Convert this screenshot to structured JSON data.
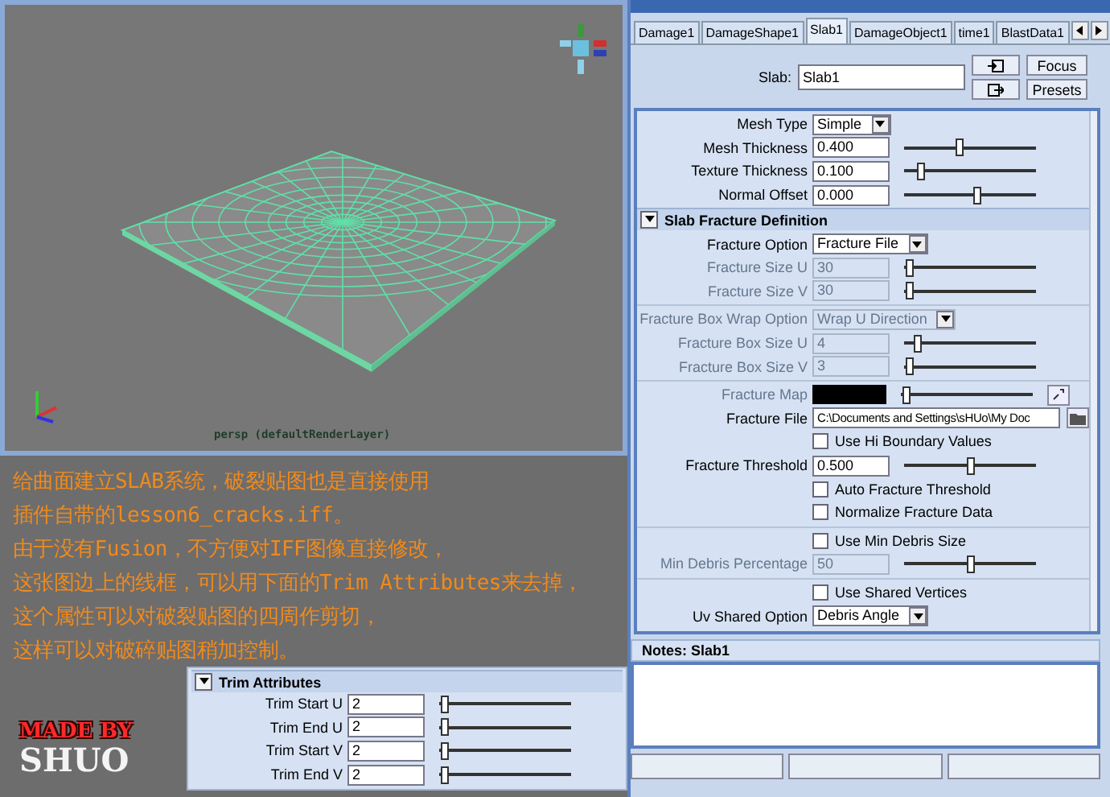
{
  "viewport": {
    "camera_label": "persp (defaultRenderLayer)"
  },
  "caption": {
    "lines": [
      "给曲面建立SLAB系统，破裂贴图也是直接使用",
      "插件自带的lesson6_cracks.iff。",
      "由于没有Fusion，不方便对IFF图像直接修改，",
      "这张图边上的线框，可以用下面的Trim Attributes来去掉，",
      "这个属性可以对破裂贴图的四周作剪切，",
      "这样可以对破碎贴图稍加控制。"
    ]
  },
  "signature": {
    "line_1": "MADE BY",
    "line_2": "SHUO"
  },
  "trim_attributes": {
    "title": "Trim Attributes",
    "expanded": true,
    "rows": [
      {
        "label": "Trim Start U",
        "value": "2",
        "level": 0.04
      },
      {
        "label": "Trim End U",
        "value": "2",
        "level": 0.04
      },
      {
        "label": "Trim Start V",
        "value": "2",
        "level": 0.04
      },
      {
        "label": "Trim End V",
        "value": "2",
        "level": 0.04
      }
    ]
  },
  "tabs": [
    {
      "label": "Damage1",
      "selected": false
    },
    {
      "label": "DamageShape1",
      "selected": false
    },
    {
      "label": "Slab1",
      "selected": true
    },
    {
      "label": "DamageObject1",
      "selected": false
    },
    {
      "label": "time1",
      "selected": false
    },
    {
      "label": "BlastData1",
      "selected": false
    }
  ],
  "node": {
    "label": "Slab:",
    "value": "Slab1",
    "buttons": [
      "Focus",
      "Presets"
    ]
  },
  "attributes": [
    {
      "kind": "dropdown",
      "label": "Mesh Type",
      "value": "Simple",
      "disabled": false
    },
    {
      "kind": "number",
      "label": "Mesh Thickness",
      "value": "0.400",
      "level": 0.42,
      "disabled": false
    },
    {
      "kind": "number",
      "label": "Texture Thickness",
      "value": "0.100",
      "level": 0.12,
      "disabled": false
    },
    {
      "kind": "number",
      "label": "Normal Offset",
      "value": "0.000",
      "level": 0.55,
      "disabled": false
    }
  ],
  "fracture_section": {
    "title": "Slab Fracture Definition",
    "expanded": true,
    "groups": [
      [
        {
          "kind": "dropdown",
          "label": "Fracture Option",
          "value": "Fracture File",
          "disabled": false
        },
        {
          "kind": "number",
          "label": "Fracture Size U",
          "value": "30",
          "level": 0.04,
          "disabled": true
        },
        {
          "kind": "number",
          "label": "Fracture Size V",
          "value": "30",
          "level": 0.04,
          "disabled": true
        }
      ],
      [
        {
          "kind": "dropdown",
          "label": "Fracture Box Wrap Option",
          "value": "Wrap U Direction",
          "disabled": true
        },
        {
          "kind": "number",
          "label": "Fracture Box Size U",
          "value": "4",
          "level": 0.1,
          "disabled": true
        },
        {
          "kind": "number",
          "label": "Fracture Box Size V",
          "value": "3",
          "level": 0.04,
          "disabled": true
        }
      ],
      [
        {
          "kind": "map",
          "label": "Fracture Map",
          "level": 0.04,
          "disabled": true
        },
        {
          "kind": "file",
          "label": "Fracture File",
          "value": "C:\\Documents and Settings\\sHUo\\My Doc",
          "disabled": false
        },
        {
          "kind": "checkbox",
          "label": "Use Hi Boundary Values",
          "checked": false,
          "disabled": false
        },
        {
          "kind": "number",
          "label": "Fracture Threshold",
          "value": "0.500",
          "level": 0.5,
          "disabled": false
        },
        {
          "kind": "checkbox",
          "label": "Auto Fracture Threshold",
          "checked": false,
          "disabled": false
        },
        {
          "kind": "checkbox",
          "label": "Normalize Fracture Data",
          "checked": false,
          "disabled": false
        }
      ],
      [
        {
          "kind": "checkbox",
          "label": "Use Min Debris Size",
          "checked": false,
          "disabled": false
        },
        {
          "kind": "number",
          "label": "Min Debris Percentage",
          "value": "50",
          "level": 0.5,
          "disabled": true
        }
      ],
      [
        {
          "kind": "checkbox",
          "label": "Use Shared Vertices",
          "checked": false,
          "disabled": false
        },
        {
          "kind": "dropdown",
          "label": "Uv Shared Option",
          "value": "Debris Angle",
          "disabled": false
        }
      ]
    ]
  },
  "notes": {
    "title": "Notes: Slab1"
  }
}
